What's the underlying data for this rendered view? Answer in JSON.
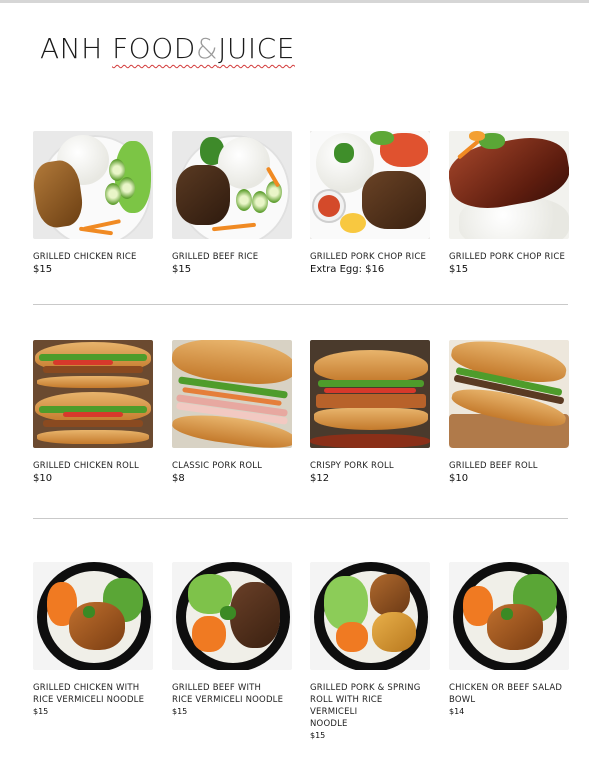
{
  "header": {
    "title_part1": "ANH ",
    "title_part2": "FOOD",
    "title_amp": "&",
    "title_part3": "JUICE"
  },
  "colors": {
    "title": "#1a1a1a",
    "ampersand": "#9a9a9a",
    "divider": "#c9c9c9",
    "spellcheck_underline": "#d23a3a"
  },
  "menu": {
    "rice": [
      {
        "name": "GRILLED CHICKEN RICE",
        "price": "$15",
        "icon": "grilled-chicken-rice-photo"
      },
      {
        "name": "GRILLED BEEF RICE",
        "price": "$15",
        "icon": "grilled-beef-rice-photo"
      },
      {
        "name": "GRILLED PORK CHOP RICE",
        "price": "Extra Egg: $16",
        "icon": "pork-chop-egg-rice-photo"
      },
      {
        "name": "GRILLED PORK CHOP RICE",
        "price": "$15",
        "icon": "pork-chop-rice-photo"
      }
    ],
    "rolls": [
      {
        "name": "GRILLED CHICKEN ROLL",
        "price": "$10",
        "icon": "chicken-roll-photo"
      },
      {
        "name": "CLASSIC PORK ROLL",
        "price": "$8",
        "icon": "classic-pork-roll-photo"
      },
      {
        "name": "CRISPY PORK ROLL",
        "price": "$12",
        "icon": "crispy-pork-roll-photo"
      },
      {
        "name": "GRILLED BEEF ROLL",
        "price": "$10",
        "icon": "beef-roll-photo"
      }
    ],
    "bowls": [
      {
        "name_line1": "GRILLED CHICKEN WITH",
        "name_line2": "RICE VERMICELI NOODLE",
        "name_line3": "",
        "price": "$15",
        "icon": "chicken-noodle-bowl-photo"
      },
      {
        "name_line1": "GRILLED BEEF WITH",
        "name_line2": "RICE VERMICELI NOODLE",
        "name_line3": "",
        "price": "$15",
        "icon": "beef-noodle-bowl-photo"
      },
      {
        "name_line1": "GRILLED PORK & SPRING",
        "name_line2": "ROLL WITH RICE VERMICELI",
        "name_line3": "NOODLE",
        "price": "$15",
        "icon": "pork-spring-roll-bowl-photo"
      },
      {
        "name_line1": "CHICKEN OR BEEF SALAD",
        "name_line2": "BOWL",
        "name_line3": "",
        "price": "$14",
        "icon": "salad-bowl-photo"
      }
    ]
  }
}
